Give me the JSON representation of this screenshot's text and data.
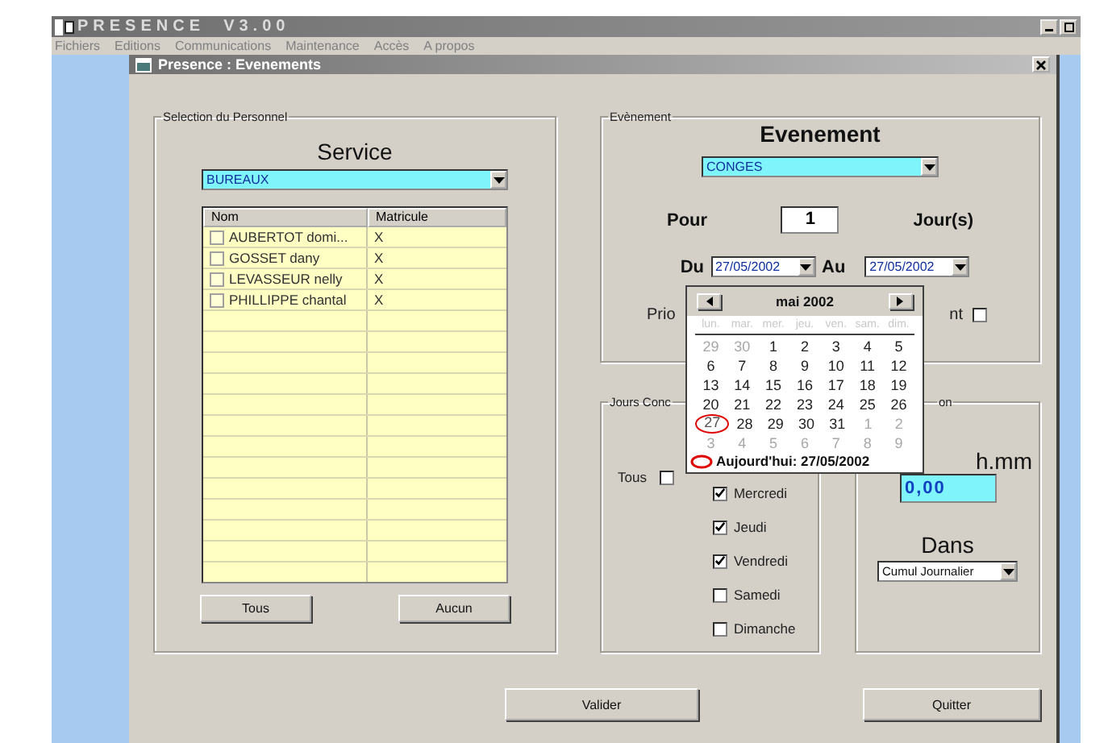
{
  "app": {
    "title": "PRESENCE  V3.00"
  },
  "menu": [
    "Fichiers",
    "Editions",
    "Communications",
    "Maintenance",
    "Accès",
    "A propos"
  ],
  "window": {
    "title": "Presence : Evenements"
  },
  "personnel": {
    "legend": "Selection du Personnel",
    "heading": "Service",
    "service": "BUREAUX",
    "columns": [
      "Nom",
      "Matricule"
    ],
    "rows": [
      {
        "name": "AUBERTOT domi...",
        "matricule": "X",
        "checked": false
      },
      {
        "name": "GOSSET dany",
        "matricule": "X",
        "checked": false
      },
      {
        "name": "LEVASSEUR nelly",
        "matricule": "X",
        "checked": false
      },
      {
        "name": "PHILLIPPE chantal",
        "matricule": "X",
        "checked": false
      }
    ],
    "buttons": [
      "Tous",
      "Aucun"
    ]
  },
  "evenement": {
    "legend": "Evènement",
    "heading": "Evenement",
    "type": "CONGES",
    "pour_label": "Pour",
    "days": "1",
    "unit": "Jour(s)",
    "du_label": "Du",
    "du": "27/05/2002",
    "au_label": "Au",
    "au": "27/05/2002",
    "label_left": "Prio",
    "label_right": "nt",
    "right_checked": false
  },
  "jours": {
    "legend": "Jours Conc",
    "tous_label": "Tous",
    "tous_checked": false,
    "days": [
      {
        "label": "Mercredi",
        "checked": true
      },
      {
        "label": "Jeudi",
        "checked": true
      },
      {
        "label": "Vendredi",
        "checked": true
      },
      {
        "label": "Samedi",
        "checked": false
      },
      {
        "label": "Dimanche",
        "checked": false
      }
    ]
  },
  "quantite": {
    "legend": "on",
    "unit": "h.mm",
    "value": "0,00",
    "dans_label": "Dans",
    "dans": "Cumul Journalier"
  },
  "calendar": {
    "month": "mai 2002",
    "weekdays": [
      "lun.",
      "mar.",
      "mer.",
      "jeu.",
      "ven.",
      "sam.",
      "dim."
    ],
    "weeks": [
      [
        {
          "day": "29",
          "in_month": false,
          "selected": false
        },
        {
          "day": "30",
          "in_month": false,
          "selected": false
        },
        {
          "day": "1",
          "in_month": true,
          "selected": false
        },
        {
          "day": "2",
          "in_month": true,
          "selected": false
        },
        {
          "day": "3",
          "in_month": true,
          "selected": false
        },
        {
          "day": "4",
          "in_month": true,
          "selected": false
        },
        {
          "day": "5",
          "in_month": true,
          "selected": false
        }
      ],
      [
        {
          "day": "6",
          "in_month": true,
          "selected": false
        },
        {
          "day": "7",
          "in_month": true,
          "selected": false
        },
        {
          "day": "8",
          "in_month": true,
          "selected": false
        },
        {
          "day": "9",
          "in_month": true,
          "selected": false
        },
        {
          "day": "10",
          "in_month": true,
          "selected": false
        },
        {
          "day": "11",
          "in_month": true,
          "selected": false
        },
        {
          "day": "12",
          "in_month": true,
          "selected": false
        }
      ],
      [
        {
          "day": "13",
          "in_month": true,
          "selected": false
        },
        {
          "day": "14",
          "in_month": true,
          "selected": false
        },
        {
          "day": "15",
          "in_month": true,
          "selected": false
        },
        {
          "day": "16",
          "in_month": true,
          "selected": false
        },
        {
          "day": "17",
          "in_month": true,
          "selected": false
        },
        {
          "day": "18",
          "in_month": true,
          "selected": false
        },
        {
          "day": "19",
          "in_month": true,
          "selected": false
        }
      ],
      [
        {
          "day": "20",
          "in_month": true,
          "selected": false
        },
        {
          "day": "21",
          "in_month": true,
          "selected": false
        },
        {
          "day": "22",
          "in_month": true,
          "selected": false
        },
        {
          "day": "23",
          "in_month": true,
          "selected": false
        },
        {
          "day": "24",
          "in_month": true,
          "selected": false
        },
        {
          "day": "25",
          "in_month": true,
          "selected": false
        },
        {
          "day": "26",
          "in_month": true,
          "selected": false
        }
      ],
      [
        {
          "day": "27",
          "in_month": true,
          "selected": true
        },
        {
          "day": "28",
          "in_month": true,
          "selected": false
        },
        {
          "day": "29",
          "in_month": true,
          "selected": false
        },
        {
          "day": "30",
          "in_month": true,
          "selected": false
        },
        {
          "day": "31",
          "in_month": true,
          "selected": false
        },
        {
          "day": "1",
          "in_month": false,
          "selected": false
        },
        {
          "day": "2",
          "in_month": false,
          "selected": false
        }
      ],
      [
        {
          "day": "3",
          "in_month": false,
          "selected": false
        },
        {
          "day": "4",
          "in_month": false,
          "selected": false
        },
        {
          "day": "5",
          "in_month": false,
          "selected": false
        },
        {
          "day": "6",
          "in_month": false,
          "selected": false
        },
        {
          "day": "7",
          "in_month": false,
          "selected": false
        },
        {
          "day": "8",
          "in_month": false,
          "selected": false
        },
        {
          "day": "9",
          "in_month": false,
          "selected": false
        }
      ]
    ],
    "today_label": "Aujourd'hui: 27/05/2002"
  },
  "buttons": [
    "Valider",
    "Quitter"
  ]
}
